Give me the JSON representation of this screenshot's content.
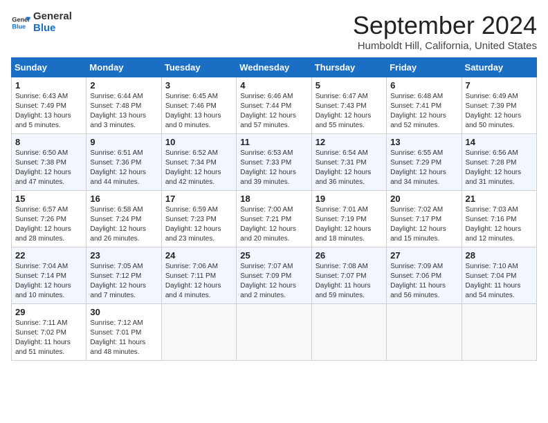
{
  "header": {
    "logo_general": "General",
    "logo_blue": "Blue",
    "month_title": "September 2024",
    "location": "Humboldt Hill, California, United States"
  },
  "weekdays": [
    "Sunday",
    "Monday",
    "Tuesday",
    "Wednesday",
    "Thursday",
    "Friday",
    "Saturday"
  ],
  "weeks": [
    [
      {
        "day": "1",
        "detail": "Sunrise: 6:43 AM\nSunset: 7:49 PM\nDaylight: 13 hours\nand 5 minutes."
      },
      {
        "day": "2",
        "detail": "Sunrise: 6:44 AM\nSunset: 7:48 PM\nDaylight: 13 hours\nand 3 minutes."
      },
      {
        "day": "3",
        "detail": "Sunrise: 6:45 AM\nSunset: 7:46 PM\nDaylight: 13 hours\nand 0 minutes."
      },
      {
        "day": "4",
        "detail": "Sunrise: 6:46 AM\nSunset: 7:44 PM\nDaylight: 12 hours\nand 57 minutes."
      },
      {
        "day": "5",
        "detail": "Sunrise: 6:47 AM\nSunset: 7:43 PM\nDaylight: 12 hours\nand 55 minutes."
      },
      {
        "day": "6",
        "detail": "Sunrise: 6:48 AM\nSunset: 7:41 PM\nDaylight: 12 hours\nand 52 minutes."
      },
      {
        "day": "7",
        "detail": "Sunrise: 6:49 AM\nSunset: 7:39 PM\nDaylight: 12 hours\nand 50 minutes."
      }
    ],
    [
      {
        "day": "8",
        "detail": "Sunrise: 6:50 AM\nSunset: 7:38 PM\nDaylight: 12 hours\nand 47 minutes."
      },
      {
        "day": "9",
        "detail": "Sunrise: 6:51 AM\nSunset: 7:36 PM\nDaylight: 12 hours\nand 44 minutes."
      },
      {
        "day": "10",
        "detail": "Sunrise: 6:52 AM\nSunset: 7:34 PM\nDaylight: 12 hours\nand 42 minutes."
      },
      {
        "day": "11",
        "detail": "Sunrise: 6:53 AM\nSunset: 7:33 PM\nDaylight: 12 hours\nand 39 minutes."
      },
      {
        "day": "12",
        "detail": "Sunrise: 6:54 AM\nSunset: 7:31 PM\nDaylight: 12 hours\nand 36 minutes."
      },
      {
        "day": "13",
        "detail": "Sunrise: 6:55 AM\nSunset: 7:29 PM\nDaylight: 12 hours\nand 34 minutes."
      },
      {
        "day": "14",
        "detail": "Sunrise: 6:56 AM\nSunset: 7:28 PM\nDaylight: 12 hours\nand 31 minutes."
      }
    ],
    [
      {
        "day": "15",
        "detail": "Sunrise: 6:57 AM\nSunset: 7:26 PM\nDaylight: 12 hours\nand 28 minutes."
      },
      {
        "day": "16",
        "detail": "Sunrise: 6:58 AM\nSunset: 7:24 PM\nDaylight: 12 hours\nand 26 minutes."
      },
      {
        "day": "17",
        "detail": "Sunrise: 6:59 AM\nSunset: 7:23 PM\nDaylight: 12 hours\nand 23 minutes."
      },
      {
        "day": "18",
        "detail": "Sunrise: 7:00 AM\nSunset: 7:21 PM\nDaylight: 12 hours\nand 20 minutes."
      },
      {
        "day": "19",
        "detail": "Sunrise: 7:01 AM\nSunset: 7:19 PM\nDaylight: 12 hours\nand 18 minutes."
      },
      {
        "day": "20",
        "detail": "Sunrise: 7:02 AM\nSunset: 7:17 PM\nDaylight: 12 hours\nand 15 minutes."
      },
      {
        "day": "21",
        "detail": "Sunrise: 7:03 AM\nSunset: 7:16 PM\nDaylight: 12 hours\nand 12 minutes."
      }
    ],
    [
      {
        "day": "22",
        "detail": "Sunrise: 7:04 AM\nSunset: 7:14 PM\nDaylight: 12 hours\nand 10 minutes."
      },
      {
        "day": "23",
        "detail": "Sunrise: 7:05 AM\nSunset: 7:12 PM\nDaylight: 12 hours\nand 7 minutes."
      },
      {
        "day": "24",
        "detail": "Sunrise: 7:06 AM\nSunset: 7:11 PM\nDaylight: 12 hours\nand 4 minutes."
      },
      {
        "day": "25",
        "detail": "Sunrise: 7:07 AM\nSunset: 7:09 PM\nDaylight: 12 hours\nand 2 minutes."
      },
      {
        "day": "26",
        "detail": "Sunrise: 7:08 AM\nSunset: 7:07 PM\nDaylight: 11 hours\nand 59 minutes."
      },
      {
        "day": "27",
        "detail": "Sunrise: 7:09 AM\nSunset: 7:06 PM\nDaylight: 11 hours\nand 56 minutes."
      },
      {
        "day": "28",
        "detail": "Sunrise: 7:10 AM\nSunset: 7:04 PM\nDaylight: 11 hours\nand 54 minutes."
      }
    ],
    [
      {
        "day": "29",
        "detail": "Sunrise: 7:11 AM\nSunset: 7:02 PM\nDaylight: 11 hours\nand 51 minutes."
      },
      {
        "day": "30",
        "detail": "Sunrise: 7:12 AM\nSunset: 7:01 PM\nDaylight: 11 hours\nand 48 minutes."
      },
      {
        "day": "",
        "detail": ""
      },
      {
        "day": "",
        "detail": ""
      },
      {
        "day": "",
        "detail": ""
      },
      {
        "day": "",
        "detail": ""
      },
      {
        "day": "",
        "detail": ""
      }
    ]
  ]
}
